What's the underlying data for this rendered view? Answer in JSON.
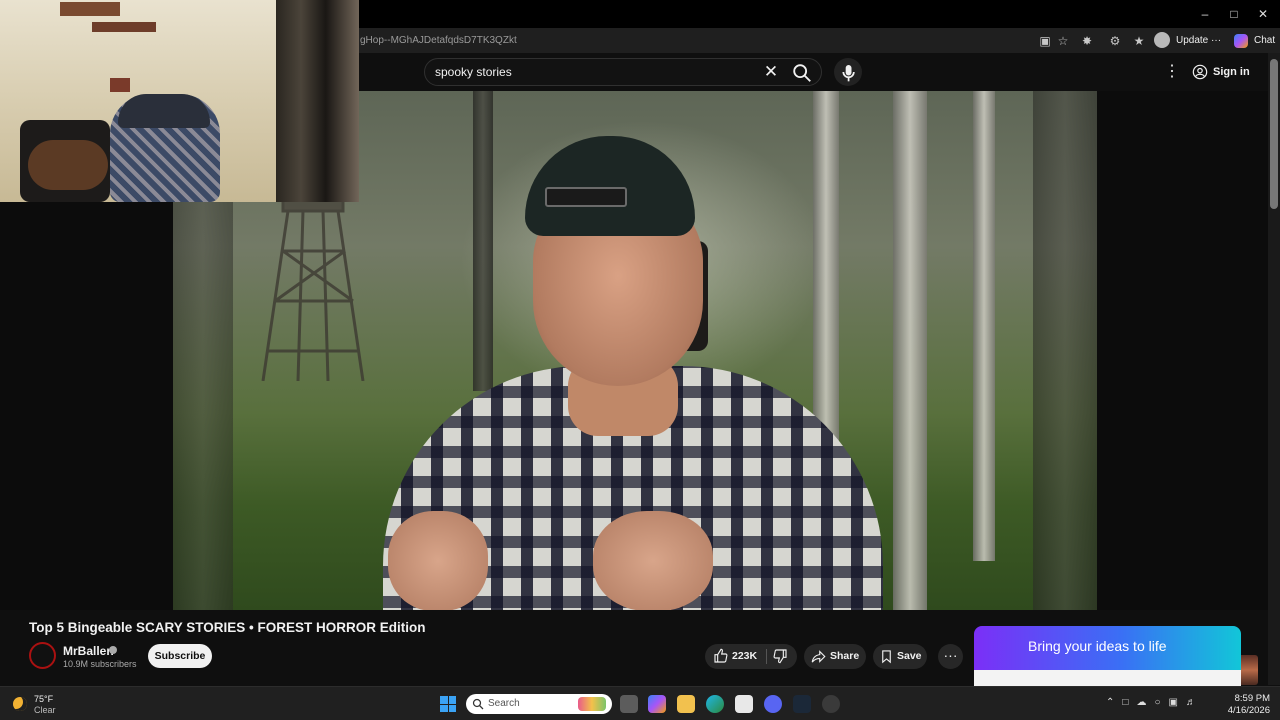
{
  "browser": {
    "url": "gHop--MGhAJDetafqdsD7TK3QZkt",
    "update_label": "Update",
    "update_more": "···",
    "chat_label": "Chat",
    "window_controls": {
      "minimize": "–",
      "maximize": "□",
      "close": "✕"
    }
  },
  "youtube": {
    "search": {
      "value": "spooky stories"
    },
    "signin_label": "Sign in",
    "video": {
      "title": "Top 5 Bingeable SCARY STORIES • FOREST HORROR Edition",
      "channel": "MrBallen",
      "subscribers": "10.9M subscribers",
      "subscribe_label": "Subscribe",
      "likes": "223K",
      "share_label": "Share",
      "save_label": "Save",
      "more_label": "···"
    },
    "ad": {
      "text": "Bring your ideas to life"
    }
  },
  "taskbar": {
    "weather_temp": "75°F",
    "weather_condition": "Clear",
    "search_placeholder": "Search",
    "time": "8:59 PM",
    "date": "4/16/2026"
  },
  "colors": {
    "youtube_bg": "#0f0f0f",
    "pill_bg": "#272727",
    "subscribe_bg": "#f1f1f1",
    "ad_gradient_start": "#7b2ff7",
    "ad_gradient_end": "#12c6d8",
    "windows_accent": "#3ba3f5"
  },
  "icons": [
    "search-icon",
    "mic-icon",
    "kebab-icon",
    "account-icon",
    "like-icon",
    "dislike-icon",
    "share-icon",
    "save-icon",
    "windows-start-icon",
    "weather-moon-icon"
  ]
}
